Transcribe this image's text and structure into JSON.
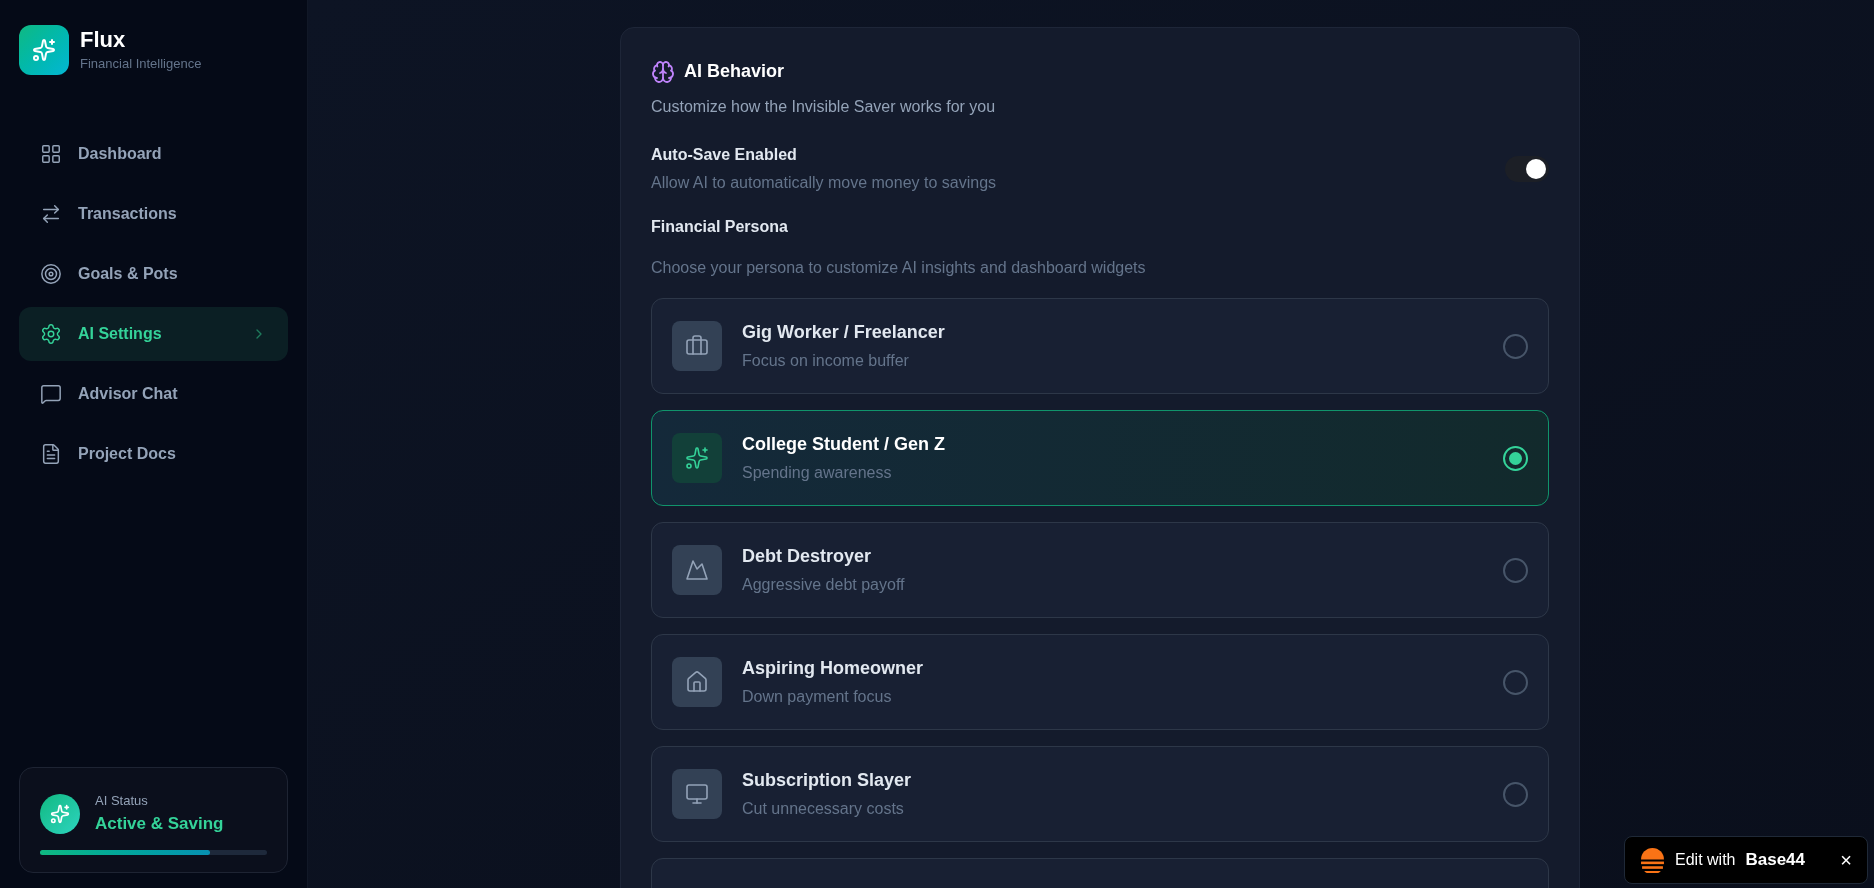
{
  "brand": {
    "name": "Flux",
    "tagline": "Financial Intelligence"
  },
  "nav": [
    {
      "label": "Dashboard",
      "selected": false
    },
    {
      "label": "Transactions",
      "selected": false
    },
    {
      "label": "Goals & Pots",
      "selected": false
    },
    {
      "label": "AI Settings",
      "selected": true
    },
    {
      "label": "Advisor Chat",
      "selected": false
    },
    {
      "label": "Project Docs",
      "selected": false
    }
  ],
  "status": {
    "label": "AI Status",
    "value": "Active & Saving",
    "level": 0.75
  },
  "card": {
    "title": "AI Behavior",
    "subtitle": "Customize how the Invisible Saver works for you",
    "auto_save": {
      "label": "Auto-Save Enabled",
      "description": "Allow AI to automatically move money to savings",
      "on": true
    },
    "persona_heading": "Financial Persona",
    "persona_hint": "Choose your persona to customize AI insights and dashboard widgets",
    "personas": [
      {
        "title": "Gig Worker / Freelancer",
        "description": "Focus on income buffer",
        "selected": false
      },
      {
        "title": "College Student / Gen Z",
        "description": "Spending awareness",
        "selected": true
      },
      {
        "title": "Debt Destroyer",
        "description": "Aggressive debt payoff",
        "selected": false
      },
      {
        "title": "Aspiring Homeowner",
        "description": "Down payment focus",
        "selected": false
      },
      {
        "title": "Subscription Slayer",
        "description": "Cut unnecessary costs",
        "selected": false
      }
    ]
  },
  "badge": {
    "prefix": "Edit with",
    "brand": "Base44",
    "close": "×"
  }
}
